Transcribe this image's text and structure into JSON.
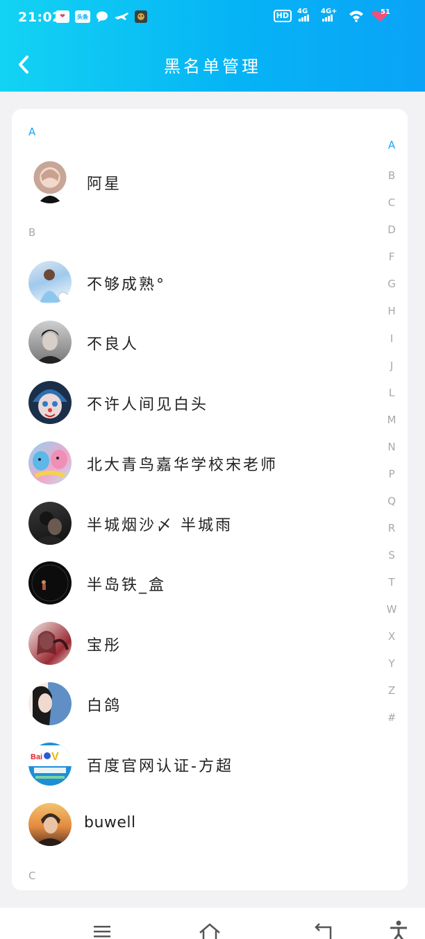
{
  "status_bar": {
    "time": "21:02",
    "notifications": [
      {
        "icon": "heart-app-icon",
        "text": "❤"
      },
      {
        "icon": "toutiao-icon",
        "text": "头条"
      },
      {
        "icon": "chat-bubble-icon",
        "text": ""
      },
      {
        "icon": "airplane-app-icon",
        "text": ""
      },
      {
        "icon": "game-app-icon",
        "text": ""
      }
    ],
    "hd_label": "HD",
    "hd_sub": "1 2",
    "signal1_label": "4G",
    "signal2_label": "4G+",
    "battery_level": "51"
  },
  "header": {
    "title": "黑名单管理",
    "back_icon": "chevron-left-icon",
    "background_start": "#13d3f3",
    "background_end": "#0aa3f7"
  },
  "sections": [
    {
      "letter": "A",
      "letter_color": "#1aa4f3"
    },
    {
      "letter": "B",
      "letter_color": "#a8a8ad"
    },
    {
      "letter": "C",
      "letter_color": "#a8a8ad"
    }
  ],
  "contacts": [
    {
      "name": "阿星",
      "avatar": "avatar-photo"
    },
    {
      "name": "不够成熟°",
      "avatar": "avatar-photo"
    },
    {
      "name": "不良人",
      "avatar": "avatar-photo"
    },
    {
      "name": "不许人间见白头",
      "avatar": "avatar-photo"
    },
    {
      "name": "北大青鸟嘉华学校宋老师",
      "avatar": "avatar-photo"
    },
    {
      "name": "半城烟沙〆 半城雨",
      "avatar": "avatar-photo"
    },
    {
      "name": "半岛铁_盒",
      "avatar": "avatar-photo"
    },
    {
      "name": "宝彤",
      "avatar": "avatar-photo"
    },
    {
      "name": "白鸽",
      "avatar": "avatar-photo"
    },
    {
      "name": "百度官网认证-方超",
      "avatar": "baidu-v-logo"
    },
    {
      "name": "buwell",
      "avatar": "avatar-photo"
    }
  ],
  "index_letters": [
    "A",
    "B",
    "C",
    "D",
    "F",
    "G",
    "H",
    "I",
    "J",
    "L",
    "M",
    "N",
    "P",
    "Q",
    "R",
    "S",
    "T",
    "W",
    "X",
    "Y",
    "Z",
    "#"
  ],
  "index_active": "A",
  "accent_color": "#1aa4f3",
  "nav_bar": {
    "icons": [
      "menu-icon",
      "home-icon",
      "back-icon",
      "accessibility-icon"
    ]
  }
}
